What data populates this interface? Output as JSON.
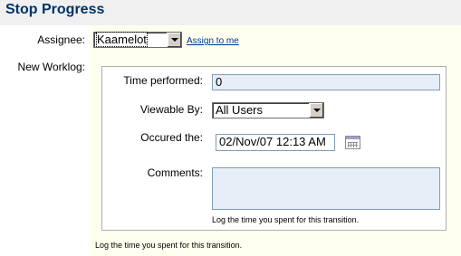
{
  "header": {
    "title": "Stop Progress"
  },
  "assignee": {
    "label": "Assignee:",
    "selected": "Kaamelot",
    "assign_to_me": "Assign to me"
  },
  "worklog": {
    "label": "New Worklog:",
    "time_performed_label": "Time performed:",
    "time_performed_value": "0",
    "viewable_by_label": "Viewable By:",
    "viewable_by_selected": "All Users",
    "occured_label": "Occured the:",
    "occured_value": "02/Nov/07 12:13 AM",
    "calendar_icon": "calendar-icon",
    "comments_label": "Comments:",
    "comments_value": "",
    "inner_help": "Log the time you spent for this transition."
  },
  "footer_help": "Log the time you spent for this transition.",
  "colors": {
    "title": "#003366",
    "header_bg": "#f0f0f0",
    "form_bg": "#fffff0",
    "input_bg": "#e8eef7",
    "link": "#003399"
  }
}
